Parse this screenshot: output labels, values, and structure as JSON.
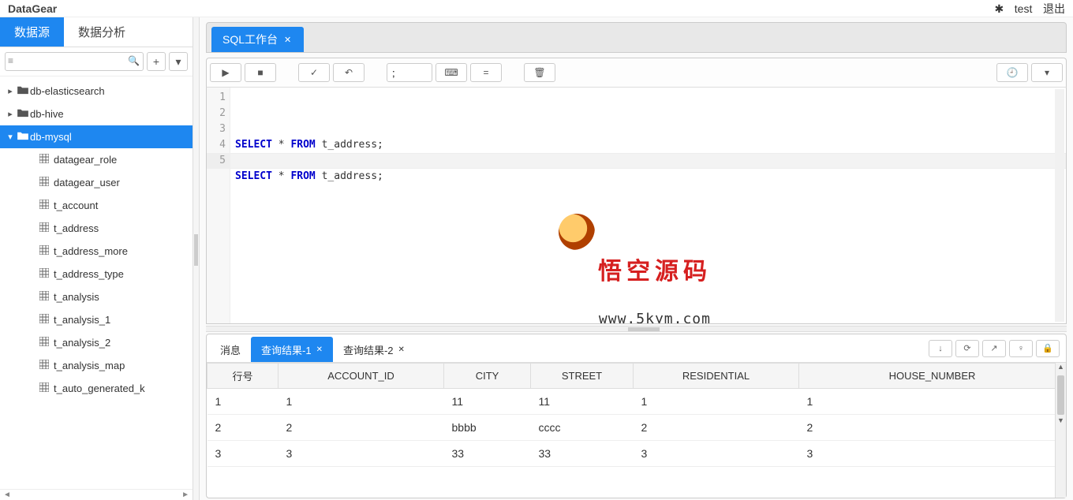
{
  "app": {
    "title": "DataGear",
    "user": "test",
    "logout": "退出"
  },
  "sidebar": {
    "tabs": [
      "数据源",
      "数据分析"
    ],
    "dbs": [
      {
        "name": "db-elasticsearch",
        "expanded": false
      },
      {
        "name": "db-hive",
        "expanded": false
      },
      {
        "name": "db-mysql",
        "expanded": true
      }
    ],
    "tables": [
      "datagear_role",
      "datagear_user",
      "t_account",
      "t_address",
      "t_address_more",
      "t_address_type",
      "t_analysis",
      "t_analysis_1",
      "t_analysis_2",
      "t_analysis_map",
      "t_auto_generated_k"
    ]
  },
  "workspace": {
    "tab": "SQL工作台",
    "delimiter": ";",
    "code_lines": [
      {
        "n": 1,
        "t": "SELECT * FROM t_address;"
      },
      {
        "n": 2,
        "t": ""
      },
      {
        "n": 3,
        "t": "SELECT * FROM t_address;"
      },
      {
        "n": 4,
        "t": ""
      },
      {
        "n": 5,
        "t": ""
      }
    ],
    "watermark": {
      "text": "悟空源码",
      "url": "www.5kym.com"
    }
  },
  "results": {
    "tabs": [
      {
        "label": "消息",
        "closable": false
      },
      {
        "label": "查询结果-1",
        "closable": true,
        "active": true
      },
      {
        "label": "查询结果-2",
        "closable": true
      }
    ],
    "columns": [
      "行号",
      "ACCOUNT_ID",
      "CITY",
      "STREET",
      "RESIDENTIAL",
      "HOUSE_NUMBER"
    ],
    "rows": [
      [
        "1",
        "1",
        "11",
        "11",
        "1",
        "1"
      ],
      [
        "2",
        "2",
        "bbbb",
        "cccc",
        "2",
        "2"
      ],
      [
        "3",
        "3",
        "33",
        "33",
        "3",
        "3"
      ]
    ]
  }
}
